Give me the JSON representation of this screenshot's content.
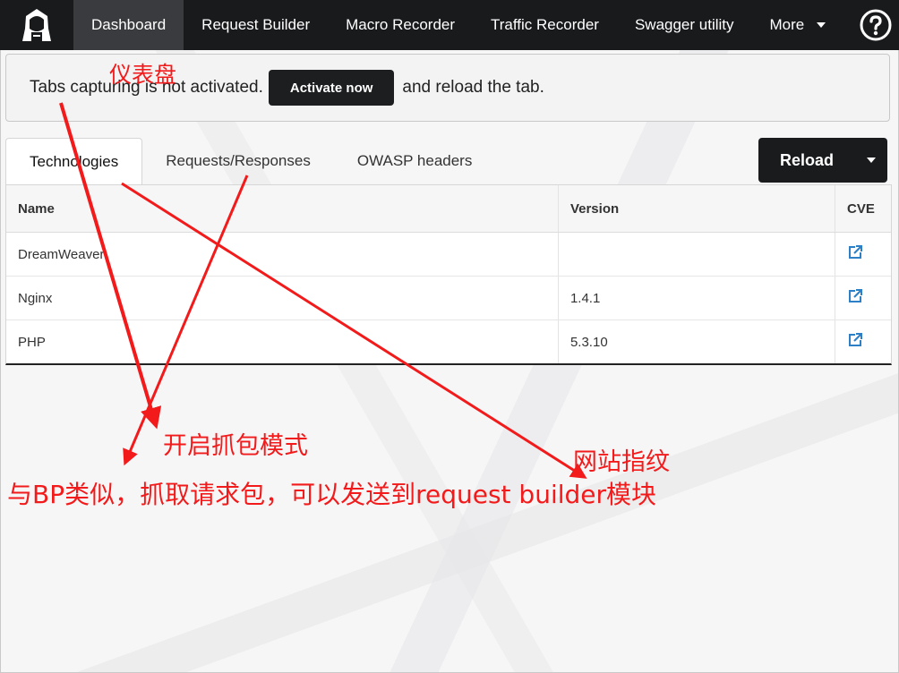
{
  "navbar": {
    "items": [
      {
        "label": "Dashboard",
        "active": true
      },
      {
        "label": "Request Builder"
      },
      {
        "label": "Macro Recorder"
      },
      {
        "label": "Traffic Recorder"
      },
      {
        "label": "Swagger utility"
      },
      {
        "label": "More",
        "dropdown": true
      }
    ]
  },
  "alert": {
    "text_before": "Tabs capturing is not activated.",
    "button_label": "Activate now",
    "text_after": "and reload the tab."
  },
  "tabs": [
    {
      "label": "Technologies",
      "active": true
    },
    {
      "label": "Requests/Responses"
    },
    {
      "label": "OWASP headers"
    }
  ],
  "reload": {
    "label": "Reload"
  },
  "table": {
    "headers": [
      "Name",
      "Version",
      "CVE"
    ],
    "rows": [
      {
        "name": "DreamWeaver",
        "version": ""
      },
      {
        "name": "Nginx",
        "version": "1.4.1"
      },
      {
        "name": "PHP",
        "version": "5.3.10"
      }
    ]
  },
  "annotations": {
    "dashboard": "仪表盘",
    "capture_mode": "开启抓包模式",
    "fingerprint": "网站指纹",
    "bp_note": "与BP类似，抓取请求包，可以发送到request builder模块"
  },
  "colors": {
    "navbar": "#191a1c",
    "nav_active": "#3a3b3e",
    "annotation": "#f21a1a",
    "link_icon": "#2d7fc6"
  }
}
